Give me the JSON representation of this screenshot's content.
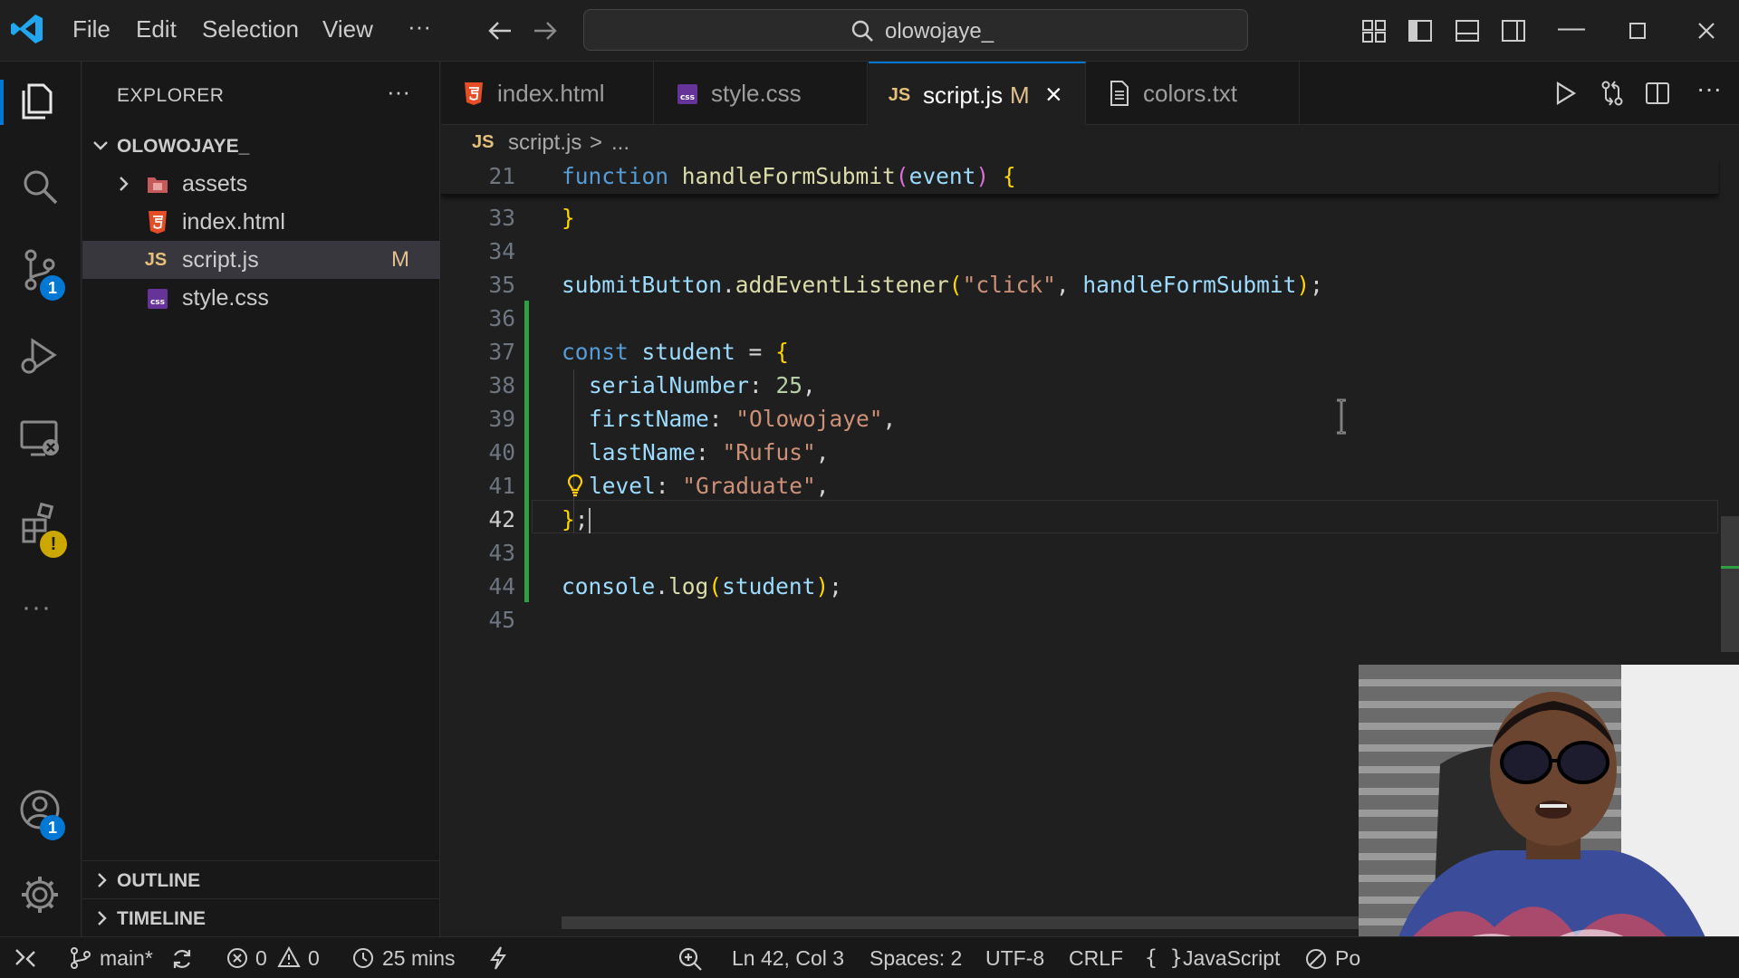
{
  "menu": {
    "file": "File",
    "edit": "Edit",
    "selection": "Selection",
    "view": "View",
    "more": "···"
  },
  "search": {
    "text": "olowojaye_"
  },
  "explorer": {
    "title": "EXPLORER",
    "more": "···",
    "root": "OLOWOJAYE_",
    "items": [
      {
        "label": "assets",
        "type": "folder"
      },
      {
        "label": "index.html",
        "type": "html"
      },
      {
        "label": "script.js",
        "type": "js",
        "status": "M"
      },
      {
        "label": "style.css",
        "type": "css"
      }
    ],
    "outline": "OUTLINE",
    "timeline": "TIMELINE"
  },
  "activity_badges": {
    "scm": "1",
    "accounts": "1",
    "extensions_warn": "!"
  },
  "tabs": [
    {
      "label": "index.html",
      "icon": "html"
    },
    {
      "label": "style.css",
      "icon": "css"
    },
    {
      "label": "script.js",
      "icon": "js",
      "status": "M",
      "close": "×"
    },
    {
      "label": "colors.txt",
      "icon": "txt"
    }
  ],
  "breadcrumb": {
    "lang": "JS",
    "file": "script.js",
    "sep": ">",
    "rest": "..."
  },
  "editor": {
    "sticky": {
      "ln": "21",
      "kw": "function",
      "fn": "handleFormSubmit",
      "open": "(",
      "param": "event",
      "close": ")",
      "brace": "{"
    },
    "lines": [
      {
        "ln": "33",
        "brace": "}"
      },
      {
        "ln": "34"
      },
      {
        "ln": "35",
        "obj": "submitButton",
        "dot": ".",
        "method": "addEventListener",
        "open": "(",
        "arg1": "\"click\"",
        "comma": ", ",
        "arg2": "handleFormSubmit",
        "close": ")",
        "semi": ";"
      },
      {
        "ln": "36"
      },
      {
        "ln": "37",
        "kw": "const",
        "name": "student",
        "eq": " = ",
        "brace": "{"
      },
      {
        "ln": "38",
        "key": "serialNumber",
        "colon": ": ",
        "value": "25",
        "comma": ","
      },
      {
        "ln": "39",
        "key": "firstName",
        "colon": ": ",
        "value": "\"Olowojaye\"",
        "comma": ","
      },
      {
        "ln": "40",
        "key": "lastName",
        "colon": ": ",
        "value": "\"Rufus\"",
        "comma": ","
      },
      {
        "ln": "41",
        "key": "level",
        "colon": ": ",
        "value": "\"Graduate\"",
        "comma": ","
      },
      {
        "ln": "42",
        "brace": "}",
        "semi": ";"
      },
      {
        "ln": "43"
      },
      {
        "ln": "44",
        "obj": "console",
        "dot": ".",
        "method": "log",
        "open": "(",
        "arg": "student",
        "close": ")",
        "semi": ";"
      },
      {
        "ln": "45"
      }
    ]
  },
  "status": {
    "branch": "main*",
    "errors": "0",
    "warnings": "0",
    "time": "25 mins",
    "position": "Ln 42, Col 3",
    "spaces": "Spaces: 2",
    "encoding": "UTF-8",
    "eol": "CRLF",
    "language": "JavaScript",
    "extra": "Po"
  },
  "colors": {
    "accent": "#0078d4",
    "git_modified": "#2ea043",
    "modified_letter": "#e2c08d",
    "html_icon": "#e44d26",
    "css_icon": "#663399",
    "js_icon": "#e5c07b"
  }
}
